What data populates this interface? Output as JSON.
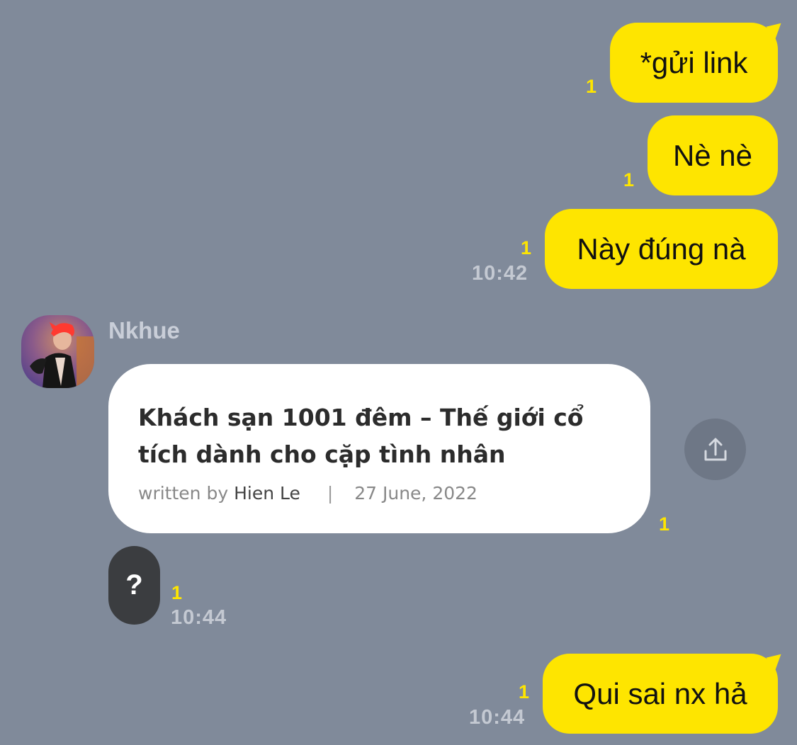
{
  "messages_out_1": [
    {
      "text": "*gửi link",
      "unread": "1"
    },
    {
      "text": "Nè nè",
      "unread": "1"
    },
    {
      "text": "Này đúng nà",
      "unread": "1",
      "time": "10:42"
    }
  ],
  "incoming": {
    "sender": "Nkhue",
    "link_card": {
      "title": "Khách sạn 1001 đêm – Thế giới cổ tích dành cho cặp tình nhân",
      "written_by_label": "written by",
      "author": "Hien Le",
      "separator": "|",
      "date": "27 June, 2022",
      "unread": "1"
    },
    "share_icon": "share-icon",
    "question": {
      "text": "?",
      "unread": "1",
      "time": "10:44"
    }
  },
  "messages_out_2": [
    {
      "text": "Qui sai nx hả",
      "unread": "1",
      "time": "10:44"
    }
  ],
  "colors": {
    "background": "#808a9a",
    "outgoing_bubble": "#fee500",
    "incoming_card": "#ffffff",
    "dark_bubble": "#3b3d40",
    "unread": "#fee500"
  }
}
